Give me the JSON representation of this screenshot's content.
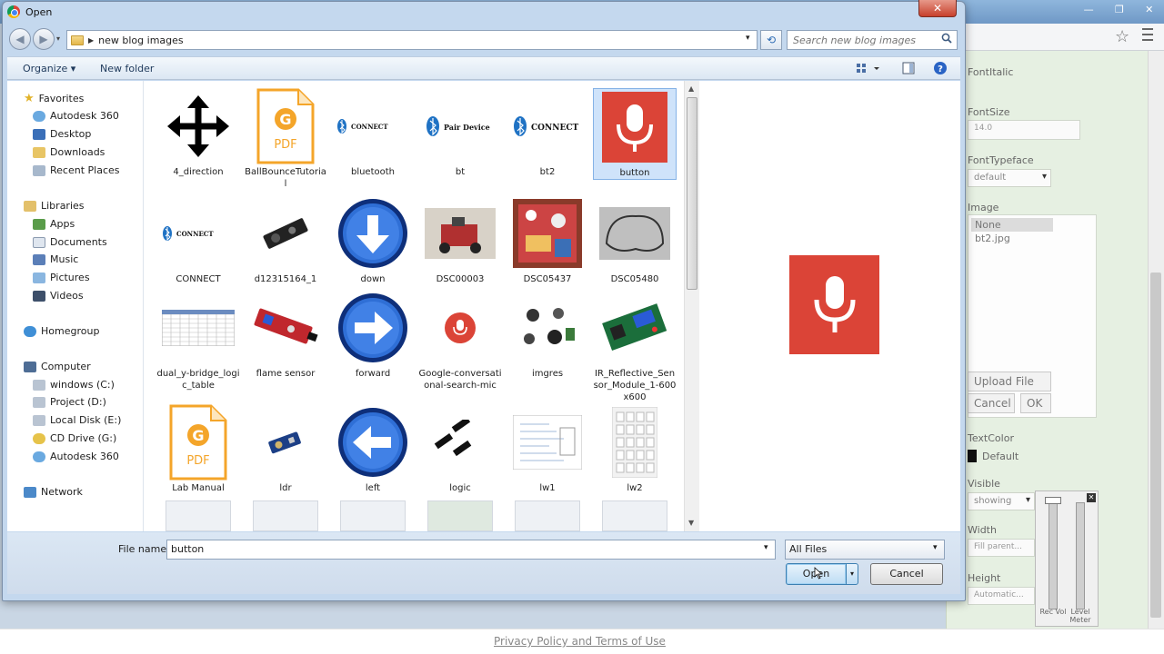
{
  "background": {
    "properties": {
      "font_italic": "FontItalic",
      "font_size": "FontSize",
      "font_size_value": "14.0",
      "font_typeface": "FontTypeface",
      "font_typeface_value": "default",
      "image": "Image",
      "image_options": [
        "None",
        "bt2.jpg"
      ],
      "upload_file": "Upload File ...",
      "cancel": "Cancel",
      "ok": "OK",
      "text_color": "TextColor",
      "text_color_value": "Default",
      "visible": "Visible",
      "visible_value": "showing",
      "width": "Width",
      "width_value": "Fill parent...",
      "height": "Height",
      "height_value": "Automatic..."
    },
    "mixer": {
      "rec_vol": "Rec Vol",
      "level_meter": "Level Meter"
    },
    "footer_link": "Privacy Policy and Terms of Use"
  },
  "dialog": {
    "title": "Open",
    "close": "✕",
    "breadcrumb": "new blog images",
    "search_placeholder": "Search new blog images",
    "toolbar": {
      "organize": "Organize",
      "new_folder": "New folder"
    },
    "nav": {
      "favorites": "Favorites",
      "fav_items": [
        "Autodesk 360",
        "Desktop",
        "Downloads",
        "Recent Places"
      ],
      "libraries": "Libraries",
      "lib_items": [
        "Apps",
        "Documents",
        "Music",
        "Pictures",
        "Videos"
      ],
      "homegroup": "Homegroup",
      "computer": "Computer",
      "comp_items": [
        "windows (C:)",
        "Project (D:)",
        "Local Disk (E:)",
        "CD Drive (G:)",
        "Autodesk 360"
      ],
      "network": "Network"
    },
    "files": [
      {
        "name": "4_direction",
        "thumb": "arrows"
      },
      {
        "name": "BallBounceTutorial",
        "thumb": "pdf"
      },
      {
        "name": "bluetooth",
        "thumb": "bt-connect"
      },
      {
        "name": "bt",
        "thumb": "bt-pair"
      },
      {
        "name": "bt2",
        "thumb": "bt-connect2"
      },
      {
        "name": "button",
        "thumb": "mic"
      },
      {
        "name": "CONNECT",
        "thumb": "bt-connect"
      },
      {
        "name": "d12315164_1",
        "thumb": "sensor-dark"
      },
      {
        "name": "down",
        "thumb": "circle-down"
      },
      {
        "name": "DSC00003",
        "thumb": "photo1"
      },
      {
        "name": "DSC05437",
        "thumb": "photo2"
      },
      {
        "name": "DSC05480",
        "thumb": "photo3"
      },
      {
        "name": "dual_y-bridge_logic_table",
        "thumb": "table"
      },
      {
        "name": "flame sensor",
        "thumb": "sensor-red"
      },
      {
        "name": "forward",
        "thumb": "circle-right"
      },
      {
        "name": "Google-conversational-search-mic",
        "thumb": "google-mic"
      },
      {
        "name": "imgres",
        "thumb": "parts"
      },
      {
        "name": "IR_Reflective_Sensor_Module_1-600x600",
        "thumb": "board"
      },
      {
        "name": "Lab Manual",
        "thumb": "pdf"
      },
      {
        "name": "ldr",
        "thumb": "sensor-blue"
      },
      {
        "name": "left",
        "thumb": "circle-left"
      },
      {
        "name": "logic",
        "thumb": "logic"
      },
      {
        "name": "lw1",
        "thumb": "doc"
      },
      {
        "name": "lw2",
        "thumb": "keypad"
      }
    ],
    "file_name_label": "File name:",
    "file_name_value": "button",
    "file_type": "All Files",
    "open": "Open",
    "cancel": "Cancel",
    "colors": {
      "accent_red": "#db4437",
      "pdf_orange": "#f4a52a",
      "circle_blue": "#2f6fd6",
      "selection": "#cfe3fa"
    }
  }
}
